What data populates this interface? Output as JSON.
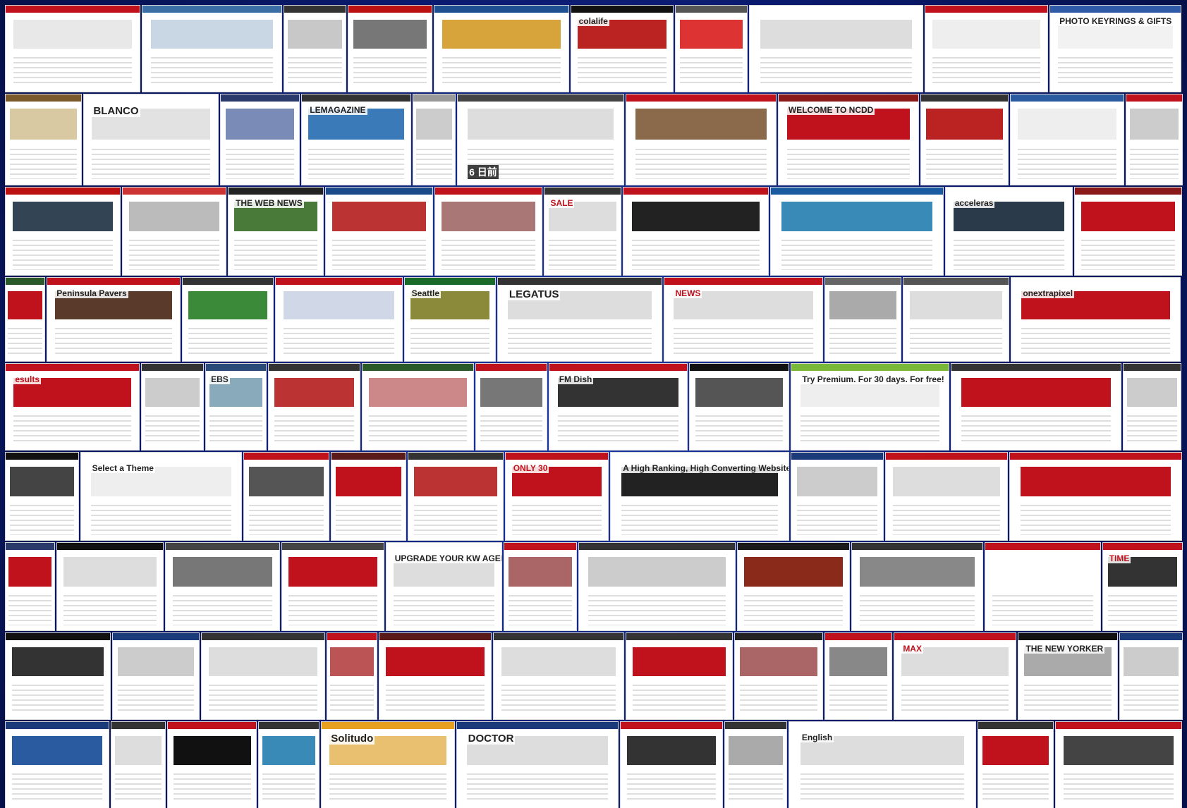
{
  "page": {
    "title": "",
    "background_color": "#0a1a6e"
  },
  "mosaic": {
    "description_of_layout": "collage of website template screenshots",
    "rows": [
      {
        "heights": 122,
        "tiles": [
          {
            "w": 185,
            "bar": "#c0121d",
            "hero": "#e8e8e8",
            "label": ""
          },
          {
            "w": 192,
            "bar": "#3a6ea5",
            "hero": "#c9d6e3",
            "label": ""
          },
          {
            "w": 85,
            "bar": "#333",
            "hero": "#c8c8c8",
            "label": ""
          },
          {
            "w": 115,
            "bar": "#b11",
            "hero": "#777",
            "label": ""
          },
          {
            "w": 185,
            "bar": "#1d4f91",
            "hero": "#d6a43a",
            "label": ""
          },
          {
            "w": 140,
            "bar": "#111",
            "hero": "#b22",
            "label": "colalife"
          },
          {
            "w": 98,
            "bar": "#555",
            "hero": "#d33",
            "label": ""
          },
          {
            "w": 238,
            "bar": "#fff",
            "hero": "#ddd",
            "label": ""
          },
          {
            "w": 168,
            "bar": "#c0121d",
            "hero": "#eee",
            "label": ""
          },
          {
            "w": 180,
            "bar": "#2f5aa8",
            "hero": "#f2f2f2",
            "label": "PHOTO KEYRINGS & GIFTS"
          }
        ]
      },
      {
        "heights": 128,
        "tiles": [
          {
            "w": 106,
            "bar": "#7a5a2a",
            "hero": "#d9c9a2",
            "label": ""
          },
          {
            "w": 188,
            "bar": "#fff",
            "hero": "#e2e2e2",
            "label": "BLANCO"
          },
          {
            "w": 110,
            "bar": "#2a3a6a",
            "hero": "#7a8bb8",
            "label": ""
          },
          {
            "w": 152,
            "bar": "#333",
            "hero": "#3a7ab8",
            "label": "LEMAGAZINE"
          },
          {
            "w": 58,
            "bar": "#999",
            "hero": "#ccc",
            "label": ""
          },
          {
            "w": 232,
            "bar": "#444",
            "hero": "#ddd",
            "label": "6 日前"
          },
          {
            "w": 210,
            "bar": "#c0121d",
            "hero": "#8a6a4a",
            "label": ""
          },
          {
            "w": 196,
            "bar": "#8a1a1a",
            "hero": "#c0121d",
            "label": "WELCOME TO NCDD"
          },
          {
            "w": 122,
            "bar": "#333",
            "hero": "#b22",
            "label": ""
          },
          {
            "w": 158,
            "bar": "#2a5aa0",
            "hero": "#eee",
            "label": ""
          },
          {
            "w": 78,
            "bar": "#c0121d",
            "hero": "#ccc",
            "label": ""
          }
        ]
      },
      {
        "heights": 124,
        "tiles": [
          {
            "w": 150,
            "bar": "#b11",
            "hero": "#345",
            "label": ""
          },
          {
            "w": 135,
            "bar": "#c33",
            "hero": "#bbb",
            "label": ""
          },
          {
            "w": 124,
            "bar": "#222",
            "hero": "#4a7a3a",
            "label": "THE WEB NEWS"
          },
          {
            "w": 140,
            "bar": "#1a4a8a",
            "hero": "#b33",
            "label": ""
          },
          {
            "w": 140,
            "bar": "#c0121d",
            "hero": "#a77",
            "label": ""
          },
          {
            "w": 100,
            "bar": "#333",
            "hero": "#ddd",
            "label": "SALE"
          },
          {
            "w": 190,
            "bar": "#c0121d",
            "hero": "#222",
            "label": ""
          },
          {
            "w": 226,
            "bar": "#1a5aa0",
            "hero": "#3a8ab8",
            "label": ""
          },
          {
            "w": 166,
            "bar": "#fff",
            "hero": "#2a3a4a",
            "label": "acceleras"
          },
          {
            "w": 140,
            "bar": "#8a1a1a",
            "hero": "#c0121d",
            "label": ""
          }
        ]
      },
      {
        "heights": 118,
        "tiles": [
          {
            "w": 52,
            "bar": "#2a5a2a",
            "hero": "#c0121d",
            "label": ""
          },
          {
            "w": 176,
            "bar": "#c0121d",
            "hero": "#5a3a2a",
            "label": "Peninsula Pavers"
          },
          {
            "w": 120,
            "bar": "#333",
            "hero": "#3a8a3a",
            "label": ""
          },
          {
            "w": 168,
            "bar": "#c0121d",
            "hero": "#d0d8e8",
            "label": ""
          },
          {
            "w": 120,
            "bar": "#1a6a2a",
            "hero": "#8a8a3a",
            "label": "Seattle"
          },
          {
            "w": 218,
            "bar": "#333",
            "hero": "#ddd",
            "label": "LEGATUS"
          },
          {
            "w": 210,
            "bar": "#c0121d",
            "hero": "#ddd",
            "label": "NEWS"
          },
          {
            "w": 100,
            "bar": "#666",
            "hero": "#aaa",
            "label": ""
          },
          {
            "w": 140,
            "bar": "#555",
            "hero": "#ddd",
            "label": ""
          },
          {
            "w": 224,
            "bar": "#fff",
            "hero": "#c0121d",
            "label": "onextrapixel"
          }
        ]
      },
      {
        "heights": 122,
        "tiles": [
          {
            "w": 178,
            "bar": "#c0121d",
            "hero": "#c0121d",
            "label": "esults"
          },
          {
            "w": 82,
            "bar": "#333",
            "hero": "#ccc",
            "label": ""
          },
          {
            "w": 80,
            "bar": "#2a4a7a",
            "hero": "#8ab",
            "label": "EBS"
          },
          {
            "w": 122,
            "bar": "#333",
            "hero": "#b33",
            "label": ""
          },
          {
            "w": 148,
            "bar": "#2a5a2a",
            "hero": "#c88",
            "label": ""
          },
          {
            "w": 94,
            "bar": "#c0121d",
            "hero": "#777",
            "label": ""
          },
          {
            "w": 184,
            "bar": "#c0121d",
            "hero": "#333",
            "label": "FM Dish"
          },
          {
            "w": 132,
            "bar": "#111",
            "hero": "#555",
            "label": ""
          },
          {
            "w": 210,
            "bar": "#7ab83a",
            "hero": "#eee",
            "label": "Try Premium. For 30 days. For free!"
          },
          {
            "w": 226,
            "bar": "#333",
            "hero": "#c0121d",
            "label": ""
          },
          {
            "w": 76,
            "bar": "#333",
            "hero": "#ccc",
            "label": ""
          }
        ]
      },
      {
        "heights": 124,
        "tiles": [
          {
            "w": 98,
            "bar": "#111",
            "hero": "#444",
            "label": ""
          },
          {
            "w": 216,
            "bar": "#fff",
            "hero": "#eee",
            "label": "Select a Theme"
          },
          {
            "w": 114,
            "bar": "#c0121d",
            "hero": "#555",
            "label": ""
          },
          {
            "w": 100,
            "bar": "#5a1a1a",
            "hero": "#c0121d",
            "label": ""
          },
          {
            "w": 128,
            "bar": "#333",
            "hero": "#b33",
            "label": ""
          },
          {
            "w": 138,
            "bar": "#c0121d",
            "hero": "#c0121d",
            "label": "ONLY 30"
          },
          {
            "w": 240,
            "bar": "#fff",
            "hero": "#222",
            "label": "A High Ranking, High Converting Website Costs Less Than You Think!"
          },
          {
            "w": 124,
            "bar": "#1a3a7a",
            "hero": "#ccc",
            "label": ""
          },
          {
            "w": 164,
            "bar": "#c0121d",
            "hero": "#ddd",
            "label": ""
          },
          {
            "w": 232,
            "bar": "#c0121d",
            "hero": "#c0121d",
            "label": ""
          }
        ]
      },
      {
        "heights": 124,
        "tiles": [
          {
            "w": 68,
            "bar": "#2a3a6a",
            "hero": "#c0121d",
            "label": ""
          },
          {
            "w": 148,
            "bar": "#111",
            "hero": "#ddd",
            "label": ""
          },
          {
            "w": 158,
            "bar": "#444",
            "hero": "#777",
            "label": ""
          },
          {
            "w": 142,
            "bar": "#444",
            "hero": "#c0121d",
            "label": ""
          },
          {
            "w": 160,
            "bar": "#fff",
            "hero": "#ddd",
            "label": "UPGRADE YOUR KW AGENT WEBSITE!"
          },
          {
            "w": 100,
            "bar": "#c0121d",
            "hero": "#a66",
            "label": ""
          },
          {
            "w": 218,
            "bar": "#333",
            "hero": "#ccc",
            "label": ""
          },
          {
            "w": 156,
            "bar": "#1a1a1a",
            "hero": "#8a2a1a",
            "label": ""
          },
          {
            "w": 182,
            "bar": "#333",
            "hero": "#888",
            "label": ""
          },
          {
            "w": 160,
            "bar": "#c0121d",
            "hero": "#fff",
            "label": ""
          },
          {
            "w": 110,
            "bar": "#c0121d",
            "hero": "#333",
            "label": "TIME"
          }
        ]
      },
      {
        "heights": 122,
        "tiles": [
          {
            "w": 148,
            "bar": "#111",
            "hero": "#333",
            "label": ""
          },
          {
            "w": 122,
            "bar": "#1a3a7a",
            "hero": "#ccc",
            "label": ""
          },
          {
            "w": 174,
            "bar": "#333",
            "hero": "#ddd",
            "label": ""
          },
          {
            "w": 70,
            "bar": "#c0121d",
            "hero": "#b55",
            "label": ""
          },
          {
            "w": 158,
            "bar": "#5a1a1a",
            "hero": "#c0121d",
            "label": ""
          },
          {
            "w": 184,
            "bar": "#333",
            "hero": "#ddd",
            "label": ""
          },
          {
            "w": 150,
            "bar": "#333",
            "hero": "#c0121d",
            "label": ""
          },
          {
            "w": 124,
            "bar": "#222",
            "hero": "#a66",
            "label": ""
          },
          {
            "w": 94,
            "bar": "#c0121d",
            "hero": "#888",
            "label": ""
          },
          {
            "w": 172,
            "bar": "#c0121d",
            "hero": "#ddd",
            "label": "MAX"
          },
          {
            "w": 140,
            "bar": "#111",
            "hero": "#aaa",
            "label": "THE NEW YORKER"
          },
          {
            "w": 90,
            "bar": "#1a3a7a",
            "hero": "#ccc",
            "label": ""
          }
        ]
      },
      {
        "heights": 122,
        "tiles": [
          {
            "w": 138,
            "bar": "#1a3a7a",
            "hero": "#2a5aa0",
            "label": ""
          },
          {
            "w": 72,
            "bar": "#333",
            "hero": "#ddd",
            "label": ""
          },
          {
            "w": 118,
            "bar": "#c0121d",
            "hero": "#111",
            "label": ""
          },
          {
            "w": 80,
            "bar": "#333",
            "hero": "#3a8ab8",
            "label": ""
          },
          {
            "w": 178,
            "bar": "#e8a020",
            "hero": "#e8c070",
            "label": "Solitudo"
          },
          {
            "w": 216,
            "bar": "#1a3a7a",
            "hero": "#ddd",
            "label": "DOCTOR"
          },
          {
            "w": 136,
            "bar": "#c0121d",
            "hero": "#333",
            "label": ""
          },
          {
            "w": 82,
            "bar": "#333",
            "hero": "#aaa",
            "label": ""
          },
          {
            "w": 250,
            "bar": "#fff",
            "hero": "#ddd",
            "label": "English"
          },
          {
            "w": 100,
            "bar": "#333",
            "hero": "#c0121d",
            "label": ""
          },
          {
            "w": 168,
            "bar": "#c0121d",
            "hero": "#444",
            "label": ""
          }
        ]
      }
    ]
  }
}
